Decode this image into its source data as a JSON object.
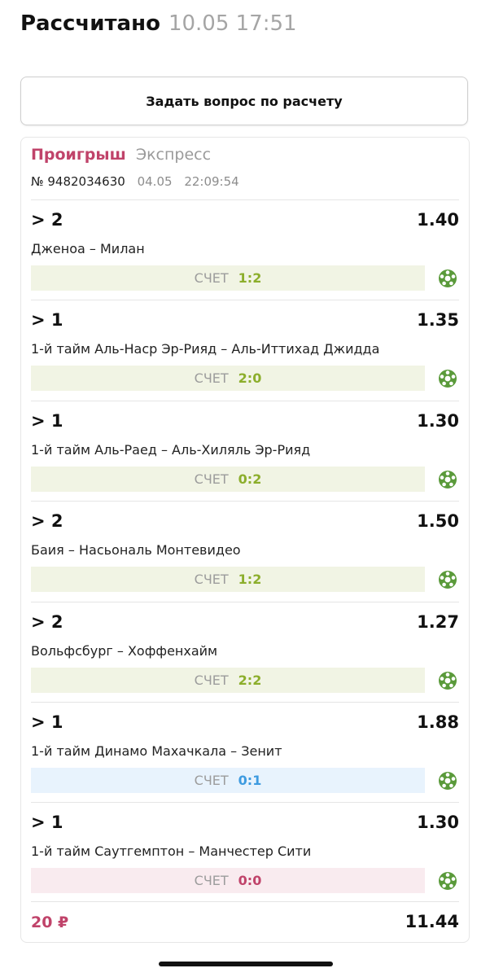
{
  "header": {
    "title": "Рассчитано",
    "time": "10.05 17:51"
  },
  "ask_button": {
    "label": "Задать вопрос по расчету"
  },
  "bet": {
    "status": "Проигрыш",
    "type": "Экспресс",
    "number": "№ 9482034630",
    "date": "04.05",
    "time": "22:09:54",
    "stake": "20 ₽",
    "total_odds": "11.44"
  },
  "events": [
    {
      "outcome": "> 2",
      "odds": "1.40",
      "match": "Дженоа – Милан",
      "score_label": "СЧЕТ",
      "score": "1:2",
      "bar_color": "#f1f4e4",
      "score_color": "#8cae2c",
      "icon": "soccer-ball-icon"
    },
    {
      "outcome": "> 1",
      "odds": "1.35",
      "match": "1-й тайм Аль-Наср Эр-Рияд – Аль-Иттихад Джидда",
      "score_label": "СЧЕТ",
      "score": "2:0",
      "bar_color": "#f1f4e4",
      "score_color": "#8cae2c",
      "icon": "soccer-ball-icon"
    },
    {
      "outcome": "> 1",
      "odds": "1.30",
      "match": "1-й тайм Аль-Раед – Аль-Хиляль Эр-Рияд",
      "score_label": "СЧЕТ",
      "score": "0:2",
      "bar_color": "#f1f4e4",
      "score_color": "#8cae2c",
      "icon": "soccer-ball-icon"
    },
    {
      "outcome": "> 2",
      "odds": "1.50",
      "match": "Баия – Насьональ Монтевидео",
      "score_label": "СЧЕТ",
      "score": "1:2",
      "bar_color": "#f1f4e4",
      "score_color": "#8cae2c",
      "icon": "soccer-ball-icon"
    },
    {
      "outcome": "> 2",
      "odds": "1.27",
      "match": "Вольфсбург – Хоффенхайм",
      "score_label": "СЧЕТ",
      "score": "2:2",
      "bar_color": "#f1f4e4",
      "score_color": "#8cae2c",
      "icon": "soccer-ball-icon"
    },
    {
      "outcome": "> 1",
      "odds": "1.88",
      "match": "1-й тайм Динамо Махачкала – Зенит",
      "score_label": "СЧЕТ",
      "score": "0:1",
      "bar_color": "#e8f3fd",
      "score_color": "#3e9be0",
      "icon": "soccer-ball-icon"
    },
    {
      "outcome": "> 1",
      "odds": "1.30",
      "match": "1-й тайм Саутгемптон – Манчестер Сити",
      "score_label": "СЧЕТ",
      "score": "0:0",
      "bar_color": "#f9ebef",
      "score_color": "#c0436a",
      "icon": "soccer-ball-icon"
    }
  ],
  "colors": {
    "lose": "#c0436a",
    "ball_green": "#5a9a3a"
  }
}
